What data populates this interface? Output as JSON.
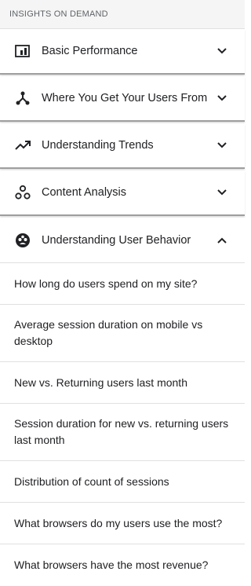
{
  "header": {
    "title": "INSIGHTS ON DEMAND"
  },
  "sections": [
    {
      "label": "Basic Performance",
      "icon": "bar-chart-icon",
      "expanded": false
    },
    {
      "label": "Where You Get Your Users From",
      "icon": "network-fork-icon",
      "expanded": false
    },
    {
      "label": "Understanding Trends",
      "icon": "trending-up-icon",
      "expanded": false
    },
    {
      "label": "Content Analysis",
      "icon": "bubbles-icon",
      "expanded": false
    },
    {
      "label": "Understanding User Behavior",
      "icon": "user-group-icon",
      "expanded": true
    }
  ],
  "behavior_items": [
    "How long do users spend on my site?",
    "Average session duration on mobile vs desktop",
    "New vs. Returning users last month",
    "Session duration for new vs. returning users last month",
    "Distribution of count of sessions",
    "What browsers do my users use the most?",
    "What browsers have the most revenue?"
  ],
  "colors": {
    "text": "#202124",
    "header_bg": "#f5f5f5",
    "divider": "#e0e0e0"
  }
}
